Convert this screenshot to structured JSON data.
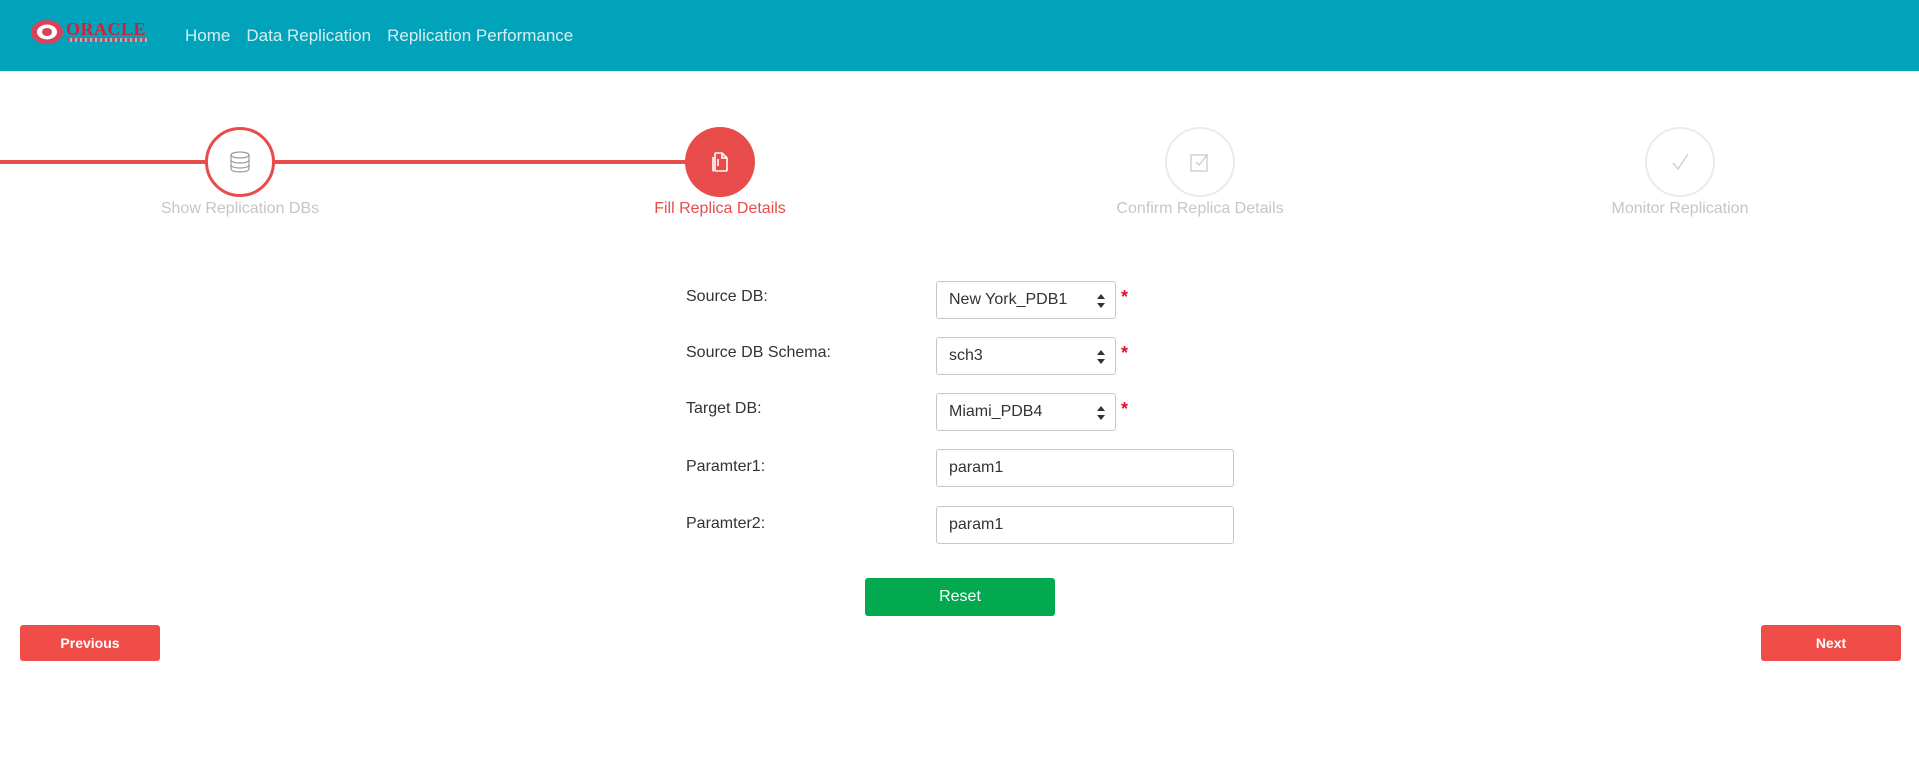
{
  "navbar": {
    "logo_text": "ORACLE",
    "links": [
      "Home",
      "Data Replication",
      "Replication Performance"
    ],
    "background": "#00a3b9"
  },
  "stepper": {
    "steps": [
      {
        "label": "Show Replication DBs",
        "icon": "database-icon",
        "state": "done"
      },
      {
        "label": "Fill Replica Details",
        "icon": "document-icon",
        "state": "active"
      },
      {
        "label": "Confirm Replica Details",
        "icon": "checkbox-icon",
        "state": "pending"
      },
      {
        "label": "Monitor Replication",
        "icon": "check-icon",
        "state": "pending"
      }
    ],
    "accent": "#e84c4a"
  },
  "form": {
    "source_db": {
      "label": "Source DB:",
      "value": "New York_PDB1",
      "required": "*"
    },
    "source_schema": {
      "label": "Source DB Schema:",
      "value": "sch3",
      "required": "*"
    },
    "target_db": {
      "label": "Target DB:",
      "value": "Miami_PDB4",
      "required": "*"
    },
    "param1": {
      "label": "Paramter1:",
      "value": "param1"
    },
    "param2": {
      "label": "Paramter2:",
      "value": "param1"
    }
  },
  "buttons": {
    "reset": "Reset",
    "previous": "Previous",
    "next": "Next",
    "reset_color": "#02a94f",
    "nav_color": "#f04c48"
  }
}
